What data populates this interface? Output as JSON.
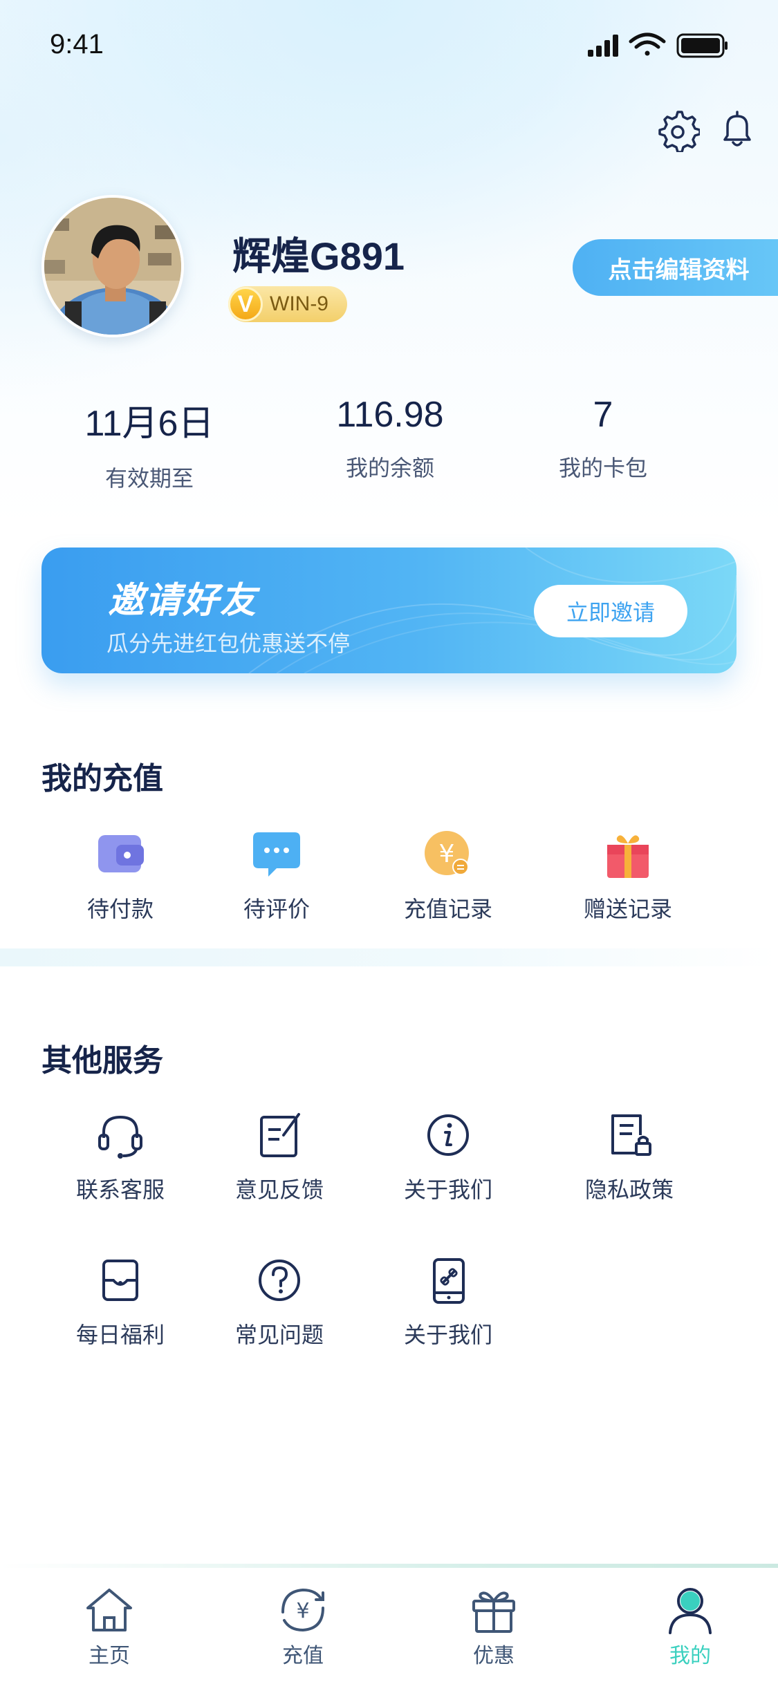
{
  "status_bar": {
    "time": "9:41"
  },
  "header": {
    "settings_icon": "gear-icon",
    "notification_icon": "bell-icon"
  },
  "profile": {
    "username": "辉煌G891",
    "vip_letter": "V",
    "vip_level": "WIN-9",
    "edit_label": "点击编辑资料"
  },
  "stats": [
    {
      "value": "11月6日",
      "label": "有效期至"
    },
    {
      "value": "116.98",
      "label": "我的余额"
    },
    {
      "value": "7",
      "label": "我的卡包"
    }
  ],
  "invite": {
    "title": "邀请好友",
    "subtitle": "瓜分先进红包优惠送不停",
    "button": "立即邀请"
  },
  "recharge": {
    "title": "我的充值",
    "items": [
      {
        "label": "待付款",
        "icon": "wallet-icon"
      },
      {
        "label": "待评价",
        "icon": "chat-bubble-icon"
      },
      {
        "label": "充值记录",
        "icon": "yuan-coin-icon"
      },
      {
        "label": "赠送记录",
        "icon": "gift-box-icon"
      }
    ]
  },
  "services": {
    "title": "其他服务",
    "items": [
      {
        "label": "联系客服",
        "icon": "headset-icon"
      },
      {
        "label": "意见反馈",
        "icon": "edit-note-icon"
      },
      {
        "label": "关于我们",
        "icon": "info-icon"
      },
      {
        "label": "隐私政策",
        "icon": "document-lock-icon"
      },
      {
        "label": "每日福利",
        "icon": "wallet-card-icon"
      },
      {
        "label": "常见问题",
        "icon": "question-icon"
      },
      {
        "label": "关于我们",
        "icon": "phone-link-icon"
      }
    ]
  },
  "tabbar": {
    "items": [
      {
        "label": "主页",
        "icon": "home-icon"
      },
      {
        "label": "充值",
        "icon": "yuan-refresh-icon"
      },
      {
        "label": "优惠",
        "icon": "gift-icon"
      },
      {
        "label": "我的",
        "icon": "user-icon"
      }
    ],
    "active_color": "#3ad0bf"
  },
  "colors": {
    "accent": "#4fb1f3",
    "text_dark": "#16244a",
    "active_tab": "#3ad0bf"
  }
}
